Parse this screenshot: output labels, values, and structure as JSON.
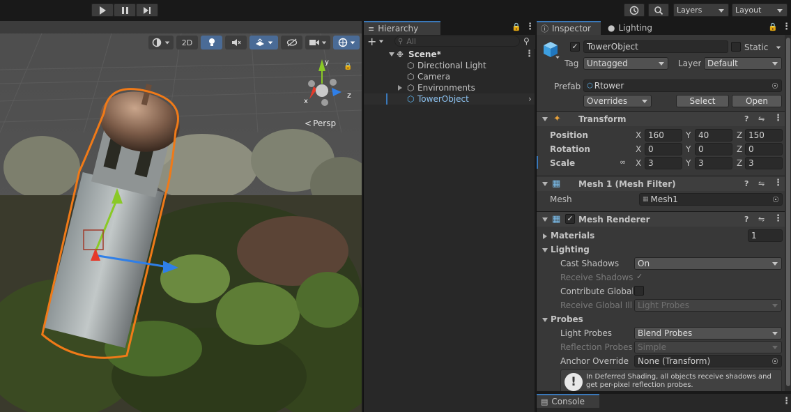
{
  "toolbar": {
    "layers_label": "Layers",
    "layout_label": "Layout"
  },
  "scene": {
    "persp_label": "Persp",
    "mode_2d": "2D",
    "gizmo_axes": {
      "x": "x",
      "y": "y",
      "z": "z"
    }
  },
  "hierarchy": {
    "tab_label": "Hierarchy",
    "search_placeholder": "All",
    "add_label": "+",
    "scene_name": "Scene*",
    "items": [
      {
        "label": "Directional Light"
      },
      {
        "label": "Camera"
      },
      {
        "label": "Environments"
      },
      {
        "label": "TowerObject"
      }
    ]
  },
  "inspector": {
    "tab_label": "Inspector",
    "lighting_tab_label": "Lighting",
    "object_name": "TowerObject",
    "static_label": "Static",
    "object_active": true,
    "tag_label": "Tag",
    "tag_value": "Untagged",
    "layer_label": "Layer",
    "layer_value": "Default",
    "prefab_label": "Prefab",
    "prefab_value": "Rtower",
    "overrides_label": "Overrides",
    "select_label": "Select",
    "open_label": "Open",
    "transform": {
      "title": "Transform",
      "position_label": "Position",
      "rotation_label": "Rotation",
      "scale_label": "Scale",
      "position": {
        "x": "160",
        "y": "40",
        "z": "150"
      },
      "rotation": {
        "x": "0",
        "y": "0",
        "z": "0"
      },
      "scale": {
        "x": "3",
        "y": "3",
        "z": "3"
      }
    },
    "mesh_filter": {
      "title": "Mesh 1 (Mesh Filter)",
      "mesh_label": "Mesh",
      "mesh_value": "Mesh1"
    },
    "mesh_renderer": {
      "title": "Mesh Renderer",
      "enabled": true,
      "materials_label": "Materials",
      "materials_count": "1",
      "lighting_label": "Lighting",
      "cast_shadows_label": "Cast Shadows",
      "cast_shadows_value": "On",
      "receive_shadows_label": "Receive Shadows",
      "receive_shadows_check": "✓",
      "contribute_gi_label": "Contribute Global I",
      "receive_gi_label": "Receive Global Illu",
      "receive_gi_value": "Light Probes",
      "probes_label": "Probes",
      "light_probes_label": "Light Probes",
      "light_probes_value": "Blend Probes",
      "reflection_probes_label": "Reflection Probes",
      "reflection_probes_value": "Simple",
      "anchor_label": "Anchor Override",
      "anchor_value": "None (Transform)",
      "info_text": "In Deferred Shading, all objects receive shadows and get per-pixel reflection probes."
    }
  },
  "console": {
    "tab_label": "Console"
  },
  "colors": {
    "accent": "#3a79bb",
    "selection": "#2c5d87",
    "outline": "#f07a18"
  }
}
